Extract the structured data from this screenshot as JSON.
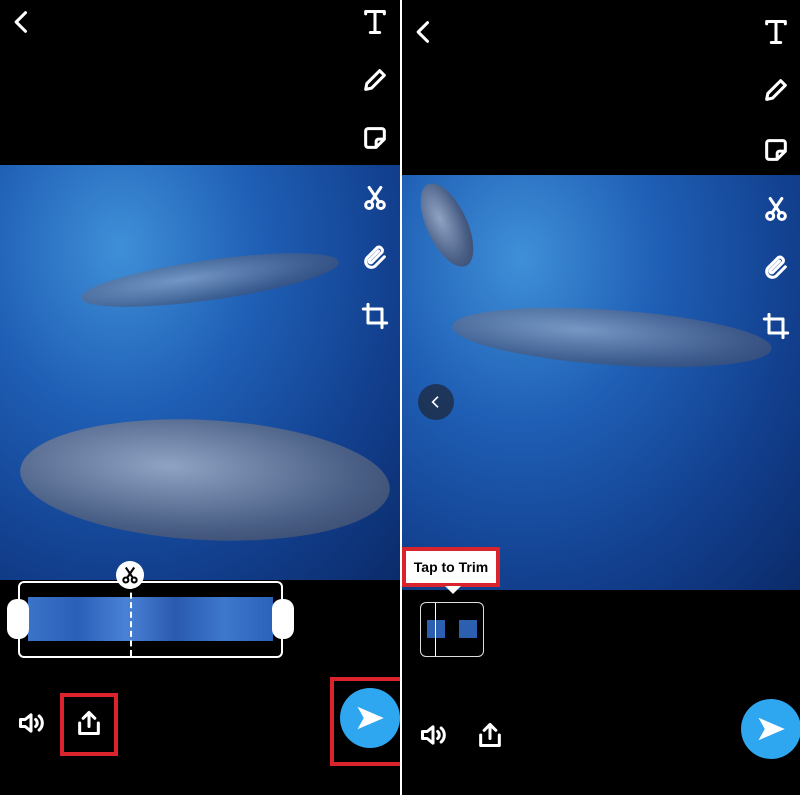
{
  "left_screen": {
    "tools": [
      "text-icon",
      "pencil-icon",
      "sticker-icon",
      "scissors-icon",
      "paperclip-icon",
      "crop-icon"
    ],
    "highlighted": [
      "share-button",
      "send-button"
    ]
  },
  "right_screen": {
    "tools": [
      "text-icon",
      "pencil-icon",
      "sticker-icon",
      "scissors-icon",
      "paperclip-icon",
      "crop-icon"
    ],
    "tooltip": "Tap to Trim"
  },
  "colors": {
    "accent": "#2ea6f0",
    "highlight": "#d9232d"
  }
}
